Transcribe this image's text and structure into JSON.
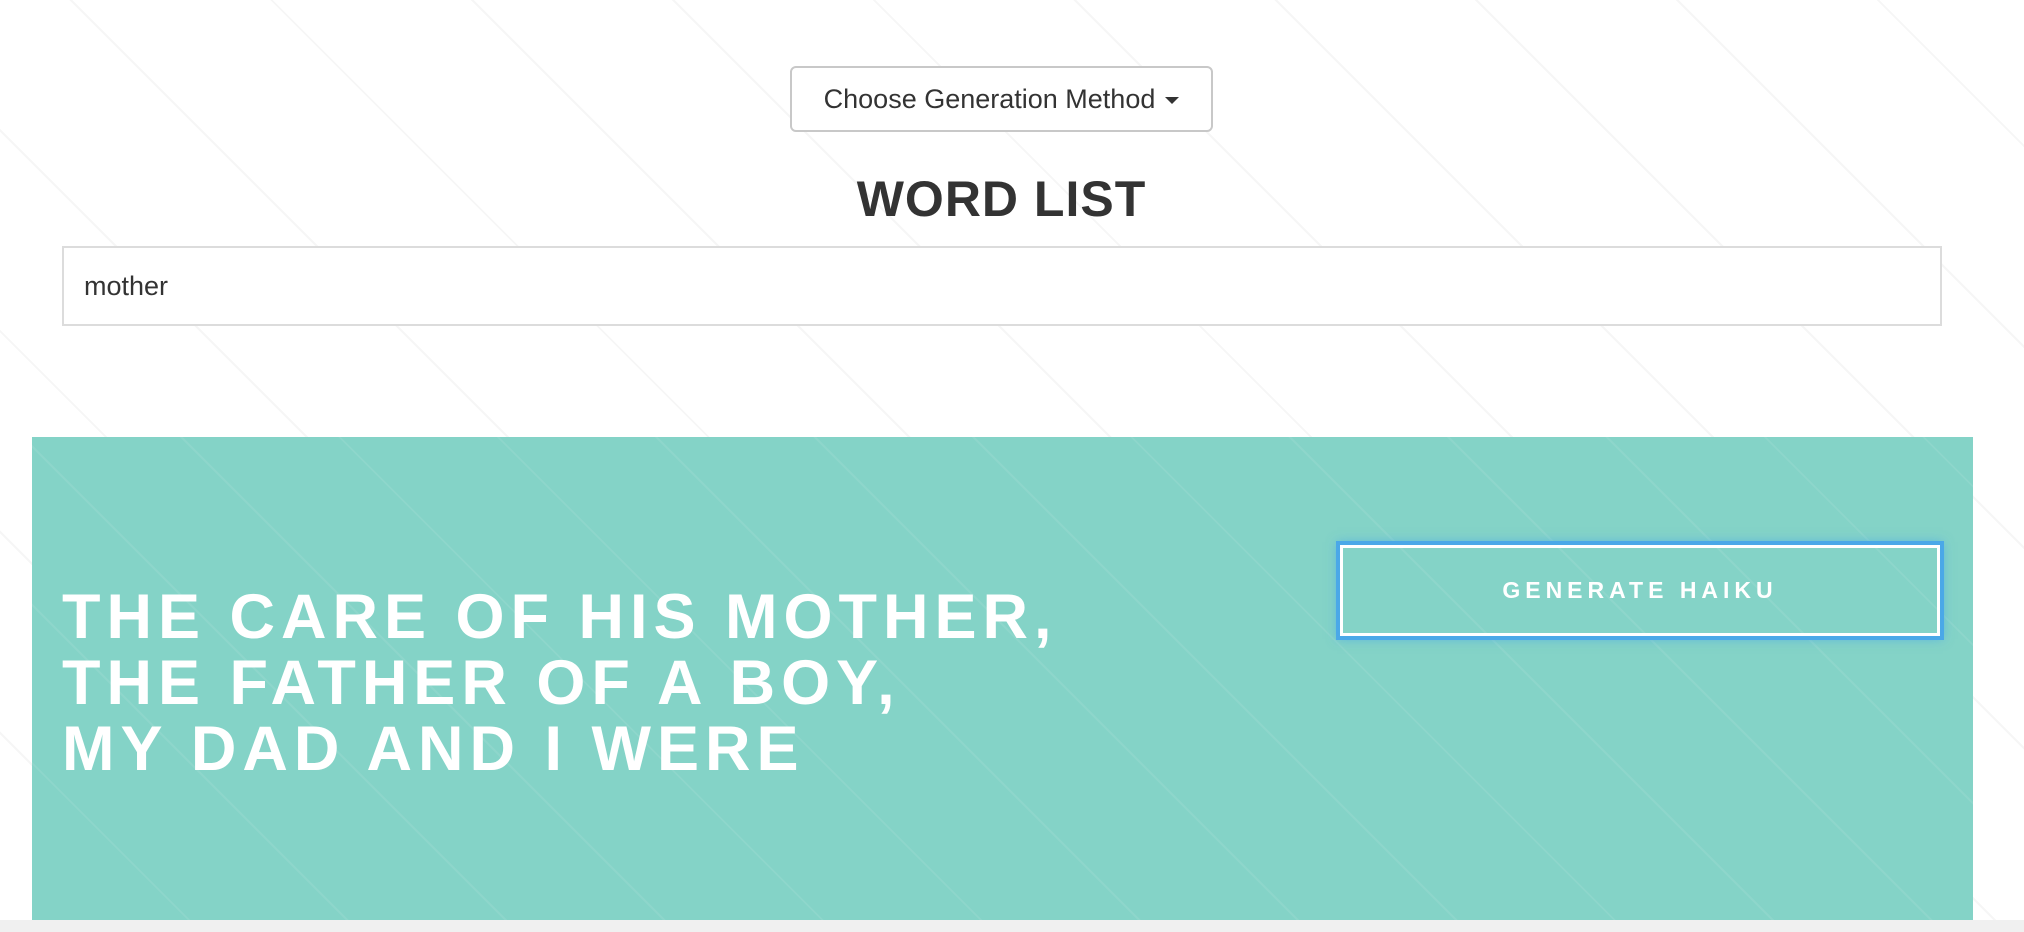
{
  "header": {
    "dropdown_label": "Choose Generation Method",
    "title": "WORD LIST"
  },
  "input": {
    "value": "mother"
  },
  "haiku": {
    "lines": [
      "THE CARE OF HIS MOTHER,",
      "THE FATHER OF A BOY,",
      "MY DAD AND I WERE"
    ],
    "button_label": "GENERATE HAIKU"
  },
  "colors": {
    "panel": "#84d3c7",
    "focus_ring": "#4aa8e8",
    "text_dark": "#333333"
  },
  "icons": {
    "dropdown": "caret-down-icon"
  }
}
